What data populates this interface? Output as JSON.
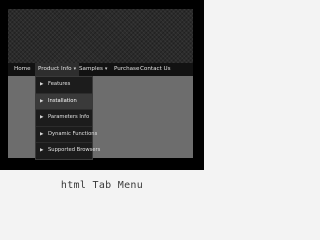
{
  "menubar": {
    "items": [
      {
        "label": "Home",
        "has_arrow": false
      },
      {
        "label": "Product Info",
        "has_arrow": true
      },
      {
        "label": "Samples",
        "has_arrow": true
      },
      {
        "label": "Purchase",
        "has_arrow": false
      },
      {
        "label": "Contact Us",
        "has_arrow": false
      }
    ]
  },
  "dropdown": {
    "items": [
      {
        "label": "Features"
      },
      {
        "label": "Installation"
      },
      {
        "label": "Parameters Info"
      },
      {
        "label": "Dynamic Functions"
      },
      {
        "label": "Supported Browsers"
      }
    ]
  },
  "caption": "html Tab Menu",
  "colors": {
    "frame": "#000000",
    "panel_dark": "#2b2b2b",
    "panel_gray": "#6d6d6d",
    "menubar_bg": "#121212",
    "dropdown_bg": "#1c1c1c",
    "dropdown_hover": "#3a3a3a",
    "page_bg": "#f3f3f3"
  },
  "icons": {
    "menu_arrow": "chevron-down-icon",
    "dropdown_bullet": "triangle-right-icon"
  }
}
